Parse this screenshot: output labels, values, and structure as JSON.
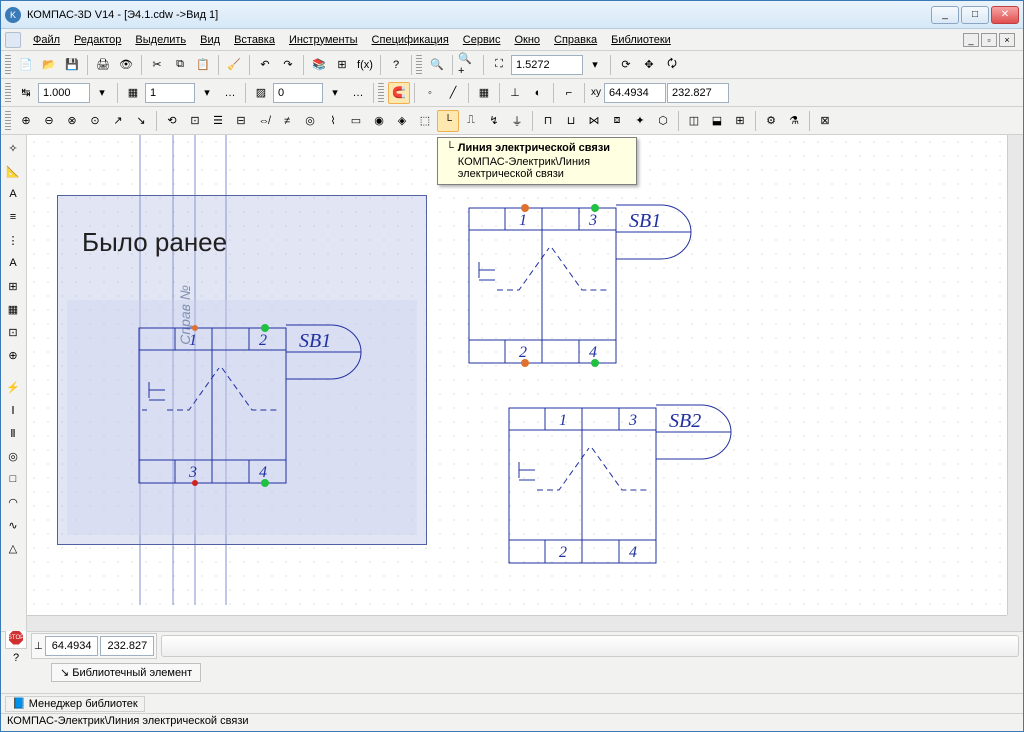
{
  "window": {
    "title": "КОМПАС-3D V14 - [Э4.1.cdw ->Вид 1]",
    "min": "_",
    "max": "□",
    "close": "✕"
  },
  "menu": {
    "items": [
      "Файл",
      "Редактор",
      "Выделить",
      "Вид",
      "Вставка",
      "Инструменты",
      "Спецификация",
      "Сервис",
      "Окно",
      "Справка",
      "Библиотеки"
    ]
  },
  "toolbar1": {
    "zoom": "1.5272"
  },
  "toolbar2": {
    "scale": "1.000",
    "layer": "1",
    "style": "0",
    "coord_x": "64.4934",
    "coord_y": "232.827"
  },
  "tooltip": {
    "title": "Линия электрической связи",
    "body": "КОМПАС-Электрик\\Линия электрической связи"
  },
  "canvas": {
    "previous_label": "Было ранее",
    "sb1": "SB1",
    "sb2": "SB2",
    "pins": {
      "p1": "1",
      "p2": "2",
      "p3": "3",
      "p4": "4"
    }
  },
  "bottom": {
    "stop": "STOP",
    "x": "64.4934",
    "y": "232.827",
    "tab": "Библиотечный элемент",
    "manager": "Менеджер библиотек"
  },
  "status": {
    "text": "КОМПАС-Электрик\\Линия электрической связи"
  }
}
